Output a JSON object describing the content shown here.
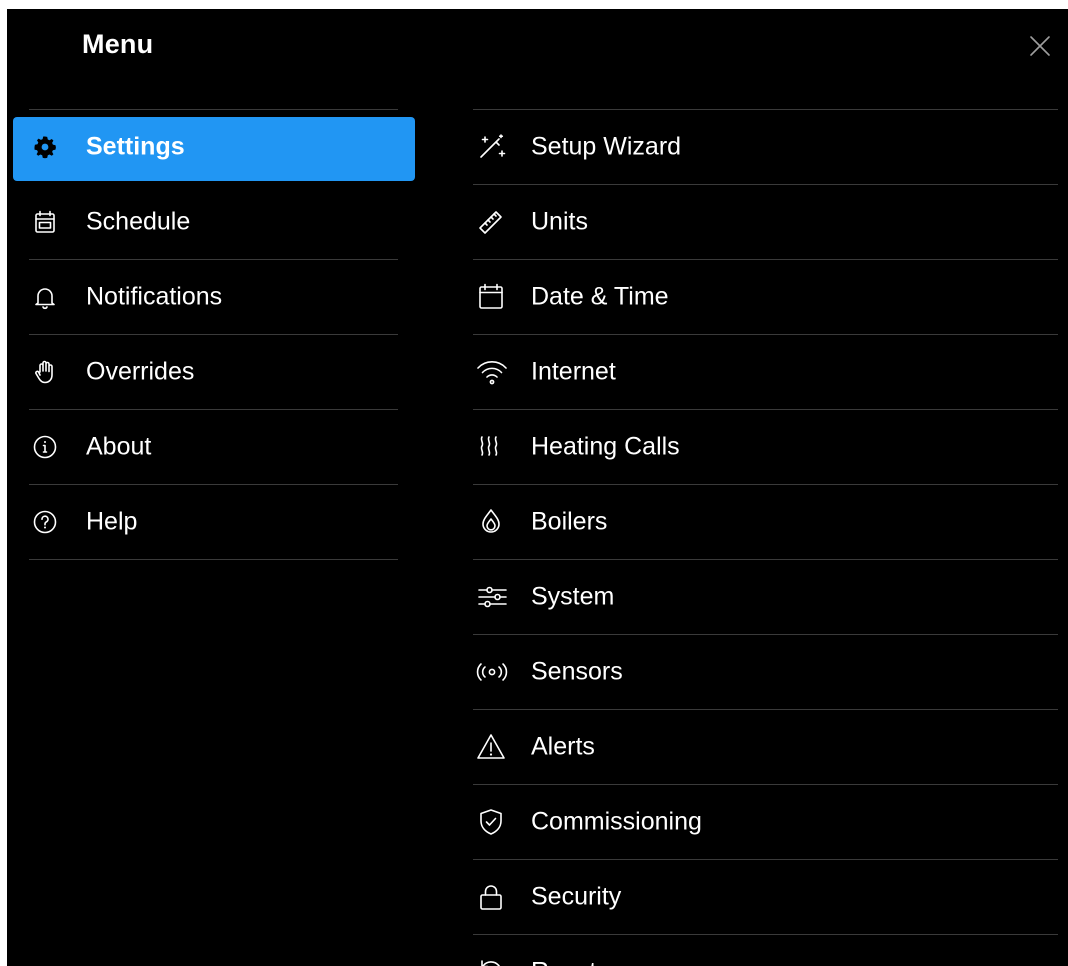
{
  "header": {
    "title": "Menu",
    "close_icon": "close-icon"
  },
  "colors": {
    "background": "#000000",
    "accent": "#2196f3",
    "divider": "#3a3a3a",
    "text": "#ffffff"
  },
  "left_menu": [
    {
      "label": "Settings",
      "icon": "gear-icon",
      "active": true
    },
    {
      "label": "Schedule",
      "icon": "calendar-schedule-icon"
    },
    {
      "label": "Notifications",
      "icon": "bell-icon"
    },
    {
      "label": "Overrides",
      "icon": "hand-icon"
    },
    {
      "label": "About",
      "icon": "info-icon"
    },
    {
      "label": "Help",
      "icon": "help-icon"
    }
  ],
  "settings_menu": [
    {
      "label": "Setup Wizard",
      "icon": "magic-wand-icon"
    },
    {
      "label": "Units",
      "icon": "ruler-icon"
    },
    {
      "label": "Date & Time",
      "icon": "calendar-icon"
    },
    {
      "label": "Internet",
      "icon": "wifi-icon"
    },
    {
      "label": "Heating Calls",
      "icon": "heat-waves-icon"
    },
    {
      "label": "Boilers",
      "icon": "water-drop-icon"
    },
    {
      "label": "System",
      "icon": "sliders-icon"
    },
    {
      "label": "Sensors",
      "icon": "sensor-icon"
    },
    {
      "label": "Alerts",
      "icon": "warning-icon"
    },
    {
      "label": "Commissioning",
      "icon": "shield-check-icon"
    },
    {
      "label": "Security",
      "icon": "lock-icon"
    },
    {
      "label": "Reset",
      "icon": "reset-icon"
    }
  ]
}
